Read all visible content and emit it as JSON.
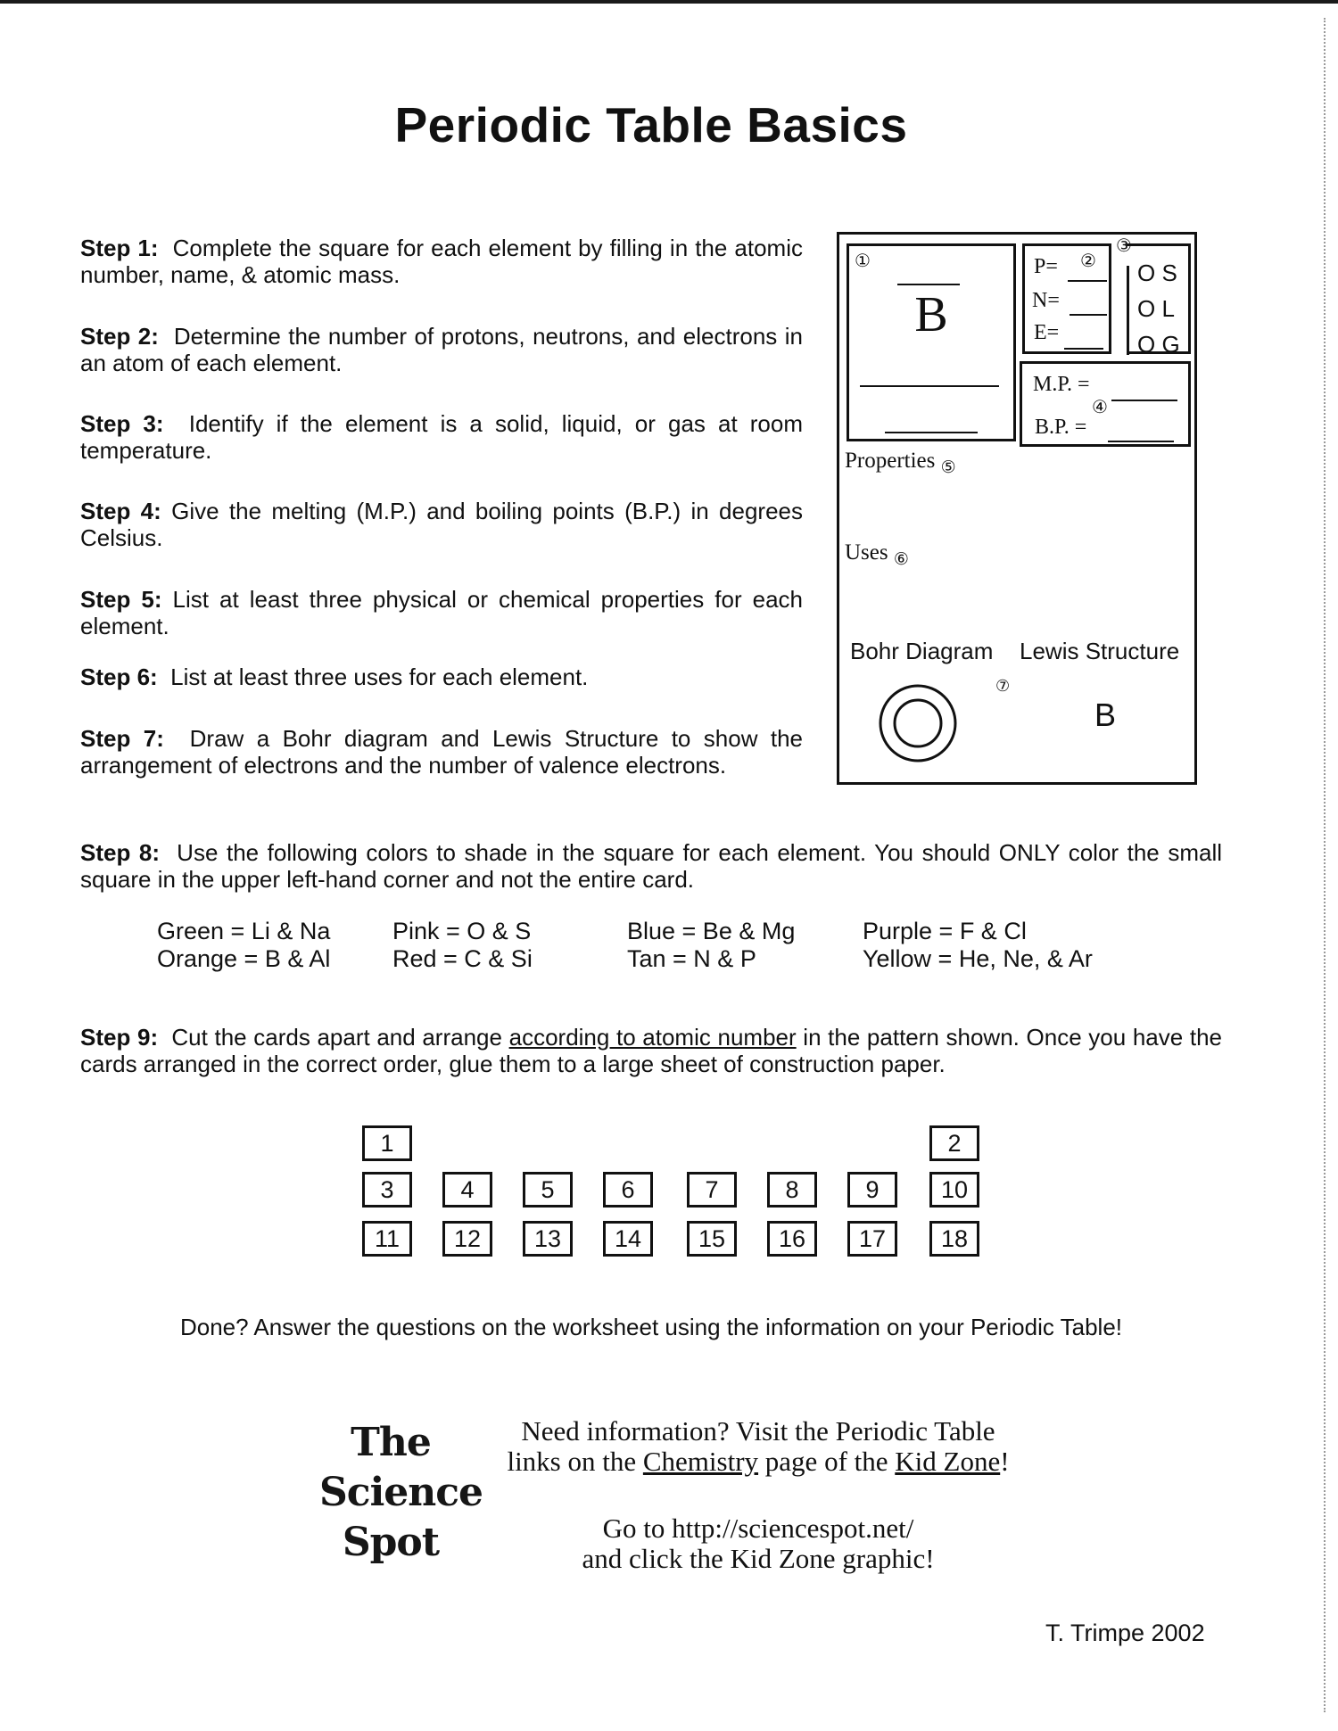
{
  "title": "Periodic Table Basics",
  "steps": [
    {
      "label": "Step 1",
      "text": "Complete the square for each element by filling in the atomic number, name, & atomic mass."
    },
    {
      "label": "Step 2",
      "text": "Determine the number of protons, neutrons, and electrons in an atom of each element."
    },
    {
      "label": "Step 3",
      "text": "Identify if the element is a solid, liquid, or gas at room temperature."
    },
    {
      "label": "Step 4",
      "text": "Give the melting (M.P.) and boiling points (B.P.) in degrees Celsius."
    },
    {
      "label": "Step 5",
      "text": "List at least three physical or chemical properties for each element."
    },
    {
      "label": "Step 6",
      "text": "List at least three uses for each element."
    },
    {
      "label": "Step 7",
      "text": "Draw a Bohr diagram and Lewis Structure to show the arrangement of electrons and the number of valence electrons."
    },
    {
      "label": "Step 8",
      "text": "Use the following colors to shade in the square for each element.  You should ONLY color the small square in the upper left-hand corner and not the entire card."
    },
    {
      "label": "Step 9",
      "text_before": "Cut the cards apart and arrange ",
      "text_underlined": "according to atomic number",
      "text_after": " in the pattern shown. Once you have the cards arranged in the correct order, glue them to a large sheet of construction paper."
    }
  ],
  "card": {
    "symbol": "B",
    "markers": [
      "①",
      "②",
      "③",
      "④",
      "⑤",
      "⑥",
      "⑦"
    ],
    "pne": {
      "p": "P=",
      "n": "N=",
      "e": "E="
    },
    "states": [
      {
        "circle": "O",
        "letter": "S"
      },
      {
        "circle": "O",
        "letter": "L"
      },
      {
        "circle": "O",
        "letter": "G"
      }
    ],
    "mp": "M.P. =",
    "bp": "B.P. =",
    "properties": "Properties",
    "uses": "Uses",
    "bohr": "Bohr Diagram",
    "lewis": "Lewis Structure",
    "lewis_symbol": "B"
  },
  "color_legend": [
    [
      "Green = Li & Na",
      "Orange = B & Al"
    ],
    [
      "Pink = O & S",
      "Red = C & Si"
    ],
    [
      "Blue = Be & Mg",
      "Tan = N & P"
    ],
    [
      "Purple = F & Cl",
      "Yellow = He, Ne, & Ar"
    ]
  ],
  "pattern": {
    "row1": [
      "1",
      "2"
    ],
    "row2": [
      "3",
      "4",
      "5",
      "6",
      "7",
      "8",
      "9",
      "10"
    ],
    "row3": [
      "11",
      "12",
      "13",
      "14",
      "15",
      "16",
      "17",
      "18"
    ]
  },
  "done_text": "Done? Answer the questions on the worksheet using the information on your Periodic Table!",
  "logo": [
    "The",
    "Science",
    "Spot"
  ],
  "info": {
    "line1": "Need information?  Visit the Periodic Table",
    "line2_before": "links on the ",
    "link_chemistry": "Chemistry",
    "line2_mid": " page of the ",
    "link_kidzone": "Kid Zone",
    "line2_after": "!",
    "line3": "Go to http://sciencespot.net/",
    "line4": "and click the Kid Zone graphic!"
  },
  "signature": "T. Trimpe 2002"
}
